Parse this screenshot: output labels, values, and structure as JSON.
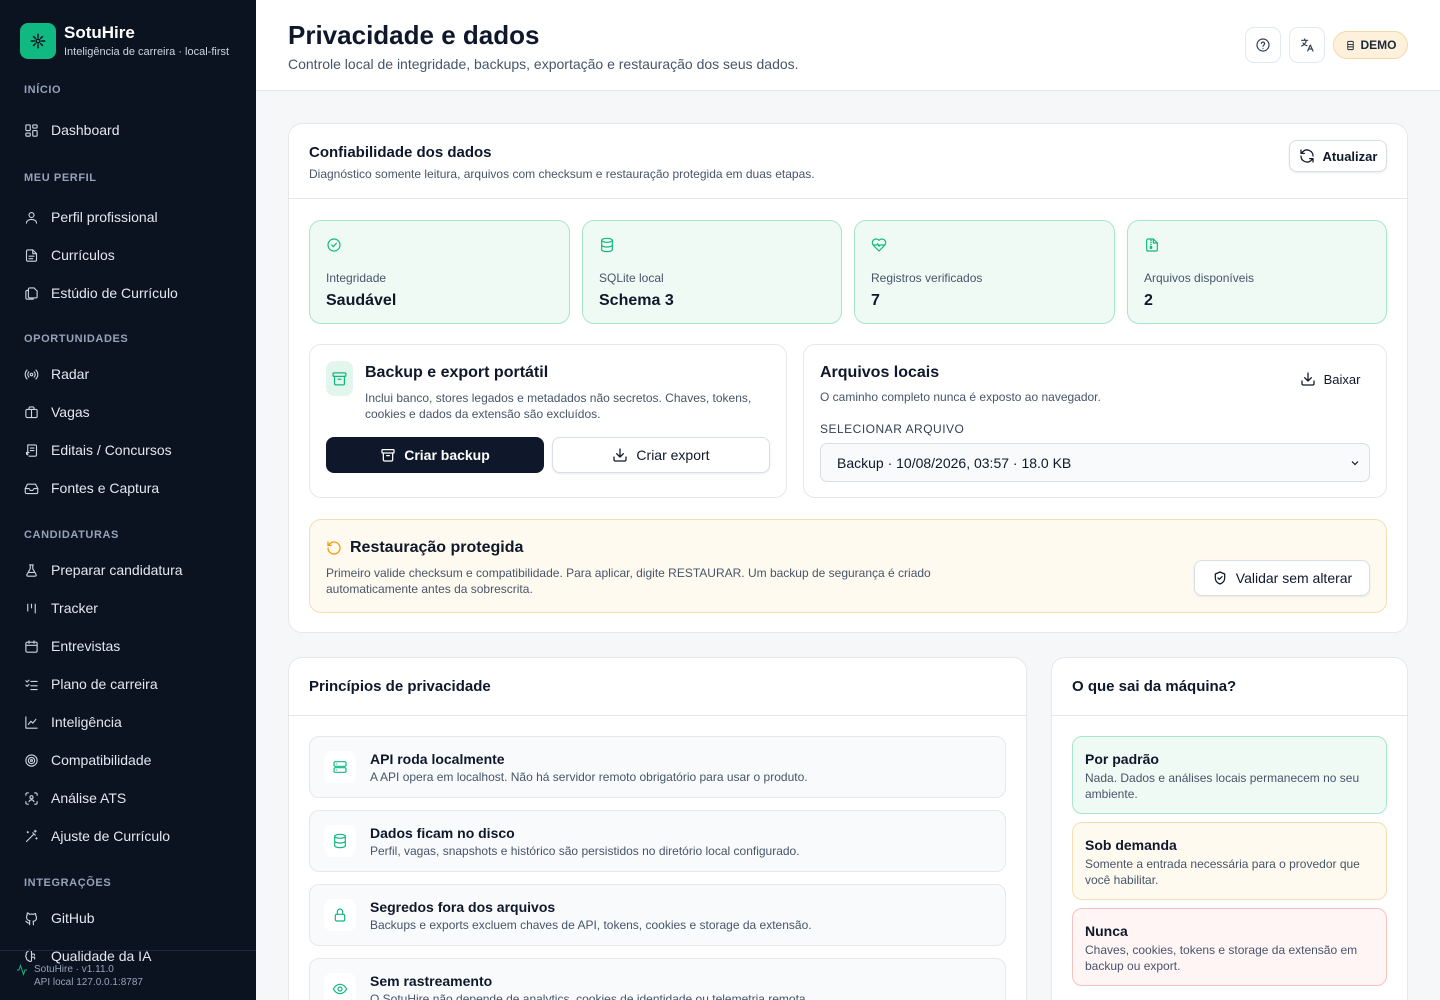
{
  "brand": {
    "name": "SotuHire",
    "subtitle": "Inteligência de carreira · local-first"
  },
  "sidebar": {
    "sections": [
      {
        "title": "INÍCIO",
        "items": [
          {
            "label": "Dashboard",
            "icon": "dashboard-icon"
          }
        ]
      },
      {
        "title": "MEU PERFIL",
        "items": [
          {
            "label": "Perfil profissional",
            "icon": "user-icon"
          },
          {
            "label": "Currículos",
            "icon": "file-icon"
          },
          {
            "label": "Estúdio de Currículo",
            "icon": "files-icon"
          }
        ]
      },
      {
        "title": "OPORTUNIDADES",
        "items": [
          {
            "label": "Radar",
            "icon": "radar-icon"
          },
          {
            "label": "Vagas",
            "icon": "briefcase-icon"
          },
          {
            "label": "Editais / Concursos",
            "icon": "scroll-icon"
          },
          {
            "label": "Fontes e Captura",
            "icon": "inbox-icon"
          }
        ]
      },
      {
        "title": "CANDIDATURAS",
        "items": [
          {
            "label": "Preparar candidatura",
            "icon": "flask-icon"
          },
          {
            "label": "Tracker",
            "icon": "kanban-icon"
          },
          {
            "label": "Entrevistas",
            "icon": "calendar-icon"
          },
          {
            "label": "Plano de carreira",
            "icon": "list-checks-icon"
          },
          {
            "label": "Inteligência",
            "icon": "chart-line-icon"
          },
          {
            "label": "Compatibilidade",
            "icon": "target-icon"
          },
          {
            "label": "Análise ATS",
            "icon": "scan-icon"
          },
          {
            "label": "Ajuste de Currículo",
            "icon": "wand-icon"
          }
        ]
      },
      {
        "title": "INTEGRAÇÕES",
        "items": [
          {
            "label": "GitHub",
            "icon": "github-icon"
          },
          {
            "label": "Qualidade da IA",
            "icon": "brain-icon"
          }
        ]
      }
    ],
    "footer": {
      "version": "SotuHire · v1.11.0",
      "api": "API local 127.0.0.1:8787"
    }
  },
  "header": {
    "title": "Privacidade e dados",
    "subtitle": "Controle local de integridade, backups, exportação e restauração dos seus dados.",
    "demo_label": "DEMO"
  },
  "reliability": {
    "title": "Confiabilidade dos dados",
    "subtitle": "Diagnóstico somente leitura, arquivos com checksum e restauração protegida em duas etapas.",
    "refresh_label": "Atualizar",
    "stats": [
      {
        "label": "Integridade",
        "value": "Saudável",
        "icon": "check-circle-icon"
      },
      {
        "label": "SQLite local",
        "value": "Schema 3",
        "icon": "database-icon"
      },
      {
        "label": "Registros verificados",
        "value": "7",
        "icon": "heart-pulse-icon"
      },
      {
        "label": "Arquivos disponíveis",
        "value": "2",
        "icon": "file-archive-icon"
      }
    ],
    "backup": {
      "title": "Backup e export portátil",
      "description": "Inclui banco, stores legados e metadados não secretos. Chaves, tokens, cookies e dados da extensão são excluídos.",
      "create_backup_label": "Criar backup",
      "create_export_label": "Criar export"
    },
    "files": {
      "title": "Arquivos locais",
      "subtitle": "O caminho completo nunca é exposto ao navegador.",
      "download_label": "Baixar",
      "select_label": "SELECIONAR ARQUIVO",
      "selected": "Backup · 10/08/2026, 03:57 · 18.0 KB"
    },
    "restore": {
      "title": "Restauração protegida",
      "description": "Primeiro valide checksum e compatibilidade. Para aplicar, digite RESTAURAR. Um backup de segurança é criado automaticamente antes da sobrescrita.",
      "validate_label": "Validar sem alterar"
    }
  },
  "principles": {
    "title": "Princípios de privacidade",
    "items": [
      {
        "title": "API roda localmente",
        "description": "A API opera em localhost. Não há servidor remoto obrigatório para usar o produto.",
        "icon": "server-icon"
      },
      {
        "title": "Dados ficam no disco",
        "description": "Perfil, vagas, snapshots e histórico são persistidos no diretório local configurado.",
        "icon": "database-icon"
      },
      {
        "title": "Segredos fora dos arquivos",
        "description": "Backups e exports excluem chaves de API, tokens, cookies e storage da extensão.",
        "icon": "lock-icon"
      },
      {
        "title": "Sem rastreamento",
        "description": "O SotuHire não depende de analytics, cookies de identidade ou telemetria remota.",
        "icon": "eye-icon"
      }
    ]
  },
  "leaves": {
    "title": "O que sai da máquina?",
    "items": [
      {
        "title": "Por padrão",
        "description": "Nada. Dados e análises locais permanecem no seu ambiente."
      },
      {
        "title": "Sob demanda",
        "description": "Somente a entrada necessária para o provedor que você habilitar."
      },
      {
        "title": "Nunca",
        "description": "Chaves, cookies, tokens e storage da extensão em backup ou export."
      }
    ]
  },
  "colors": {
    "accent": "#10b981",
    "sidebar_bg": "#0b1220",
    "warning_bg": "#fffaf0",
    "danger_bg": "#fff5f5"
  }
}
